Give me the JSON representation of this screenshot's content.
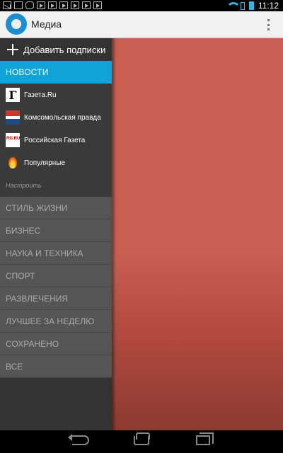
{
  "app": {
    "title": "Медиа"
  },
  "status": {
    "time": "11:12"
  },
  "drawer": {
    "add_label": "Добавить подписки",
    "section_header": "НОВОСТИ",
    "sources": [
      {
        "label": "Газета.Ru",
        "icon": "gazeta-ru-logo-icon"
      },
      {
        "label": "Комсомольская правда",
        "icon": "kp-logo-icon"
      },
      {
        "label": "Российская Газета",
        "icon": "rg-logo-icon"
      },
      {
        "label": "Популярные",
        "icon": "fire-icon"
      }
    ],
    "settings_label": "Настроить",
    "categories": [
      "СТИЛЬ ЖИЗНИ",
      "БИЗНЕС",
      "НАУКА И ТЕХНИКА",
      "СПОРТ",
      "РАЗВЛЕЧЕНИЯ",
      "ЛУЧШЕЕ ЗА НЕДЕЛЮ",
      "СОХРАНЕНО",
      "ВСЕ"
    ]
  },
  "colors": {
    "accent": "#0fa3d8",
    "content_bg": "#c95e51"
  }
}
